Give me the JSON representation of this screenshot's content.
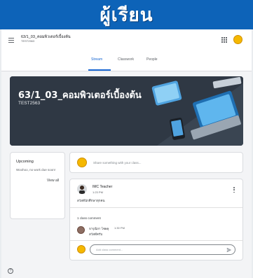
{
  "banner": {
    "title": "ผู้เรียน"
  },
  "header": {
    "class_title": "63/1_03_คอมพิวเตอร์เบื้องต้น",
    "class_subtitle": "TEST2563"
  },
  "tabs": [
    {
      "label": "Stream",
      "active": true
    },
    {
      "label": "Classwork",
      "active": false
    },
    {
      "label": "People",
      "active": false
    }
  ],
  "hero": {
    "title": "63/1_03_คอมพิวเตอร์เบื้องต้น",
    "section": "TEST2563"
  },
  "upcoming": {
    "title": "Upcoming",
    "empty_text": "Woohoo, no work due soon!",
    "view_all": "View all"
  },
  "share": {
    "placeholder": "Share something with your class..."
  },
  "post": {
    "author": "IMC Teacher",
    "time": "1:23 PM",
    "body": "สวัสดีนักศึกษาทุกคน",
    "comments_count": "1 class comment",
    "comment": {
      "author": "จารุณิภา โชยคุ",
      "time": "1:30 PM",
      "text": "สวัสดีครับ"
    },
    "comment_placeholder": "Add class comment..."
  },
  "colors": {
    "banner": "#0d63b8",
    "accent": "#1967d2",
    "hero": "#2f3844",
    "avatar": "#f5b800"
  },
  "icons": [
    "menu-icon",
    "apps-icon",
    "more-vert-icon",
    "send-icon",
    "help-icon"
  ]
}
